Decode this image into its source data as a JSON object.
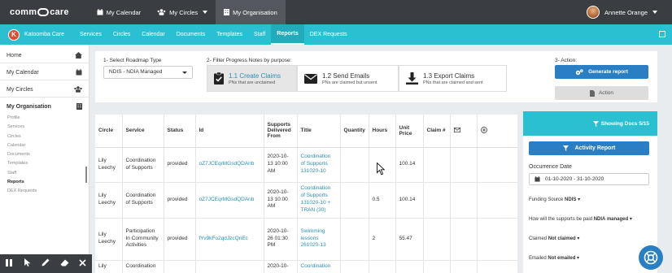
{
  "topbar": {
    "logo_text_a": "comm",
    "logo_text_b": "care",
    "nav": [
      {
        "label": "My Calendar",
        "icon": "calendar-icon"
      },
      {
        "label": "My Circles",
        "icon": "users-icon"
      },
      {
        "label": "My Organisation",
        "icon": "building-icon"
      }
    ],
    "user_name": "Annette Orange"
  },
  "tealbar": {
    "badge": "K",
    "tenant": "Katoomba Care",
    "nav": [
      "Services",
      "Circles",
      "Calendar",
      "Documents",
      "Templates",
      "Staff",
      "Reports",
      "DEX Requests"
    ],
    "active": "Reports"
  },
  "sidebar": {
    "items": [
      "Home",
      "My Calendar",
      "My Circles"
    ],
    "section": "My Organisation",
    "subitems": [
      "Profile",
      "Services",
      "Circles",
      "Calendar",
      "Documents",
      "Templates",
      "Staff",
      "Reports",
      "DEX Requests"
    ]
  },
  "filters": {
    "roadmap_label": "1- Select Roadmap Type",
    "roadmap_value": "NDIS - NDIA Managed",
    "progress_label": "2- Filter Progress Notes by purpose:",
    "steps": [
      {
        "title": "1.1 Create Claims",
        "sub": "PNs that are unclaimed"
      },
      {
        "title": "1.2 Send Emails",
        "sub": "PNs are claimed but unsent"
      },
      {
        "title": "1.3 Export Claims",
        "sub": "PNs that are claimed and sent"
      }
    ],
    "action_label": "3- Action:",
    "generate_label": "Generate report",
    "action_button": "Action"
  },
  "table": {
    "headers": [
      "Circle",
      "Service",
      "Status",
      "Id",
      "Supports Delivered From",
      "Title",
      "Quantity",
      "Hours",
      "Unit Price",
      "Claim #"
    ],
    "rows": [
      {
        "circle": "Lily Leechy",
        "service": "Coordination of Supports",
        "status": "provided",
        "id": "oZ7JCEqrMGsdQDAnb",
        "from": "2020-10-13 10:00 AM",
        "title": "Coordination of Supports 131020-10",
        "quantity": "",
        "hours": "",
        "price": "100.14",
        "claim": ""
      },
      {
        "circle": "Lily Leechy",
        "service": "Coordination of Supports",
        "status": "provided",
        "id": "oZ7JCEqrMGsdQDAnb",
        "from": "2020-10-13 10:00 AM",
        "title": "Coordination of Supports 131020-10 + TRAN (30)",
        "quantity": "",
        "hours": "0.5",
        "price": "100.14",
        "claim": ""
      },
      {
        "circle": "Lily Leechy",
        "service": "Participation In Community Activities",
        "status": "provided",
        "id": "fYv9kFo2qdJzcQnEc",
        "from": "2020-10-26 01:30 PM",
        "title": "Swimming lessons 261020-13",
        "quantity": "",
        "hours": "2",
        "price": "55.47",
        "claim": ""
      },
      {
        "circle": "Lily",
        "service": "Coordination",
        "status": "",
        "id": "",
        "from": "2020-10-",
        "title": "Coordination",
        "quantity": "",
        "hours": "",
        "price": "",
        "claim": ""
      }
    ]
  },
  "rightpanel": {
    "showing": "Showing Docs 5/15",
    "activity_button": "Activity Report",
    "occurrence_label": "Occurrence Date",
    "date_range": "01-10-2020 - 31-10-2020",
    "funding_label": "Funding Source",
    "funding_value": "NDIS",
    "paid_label": "How will the supports be paid",
    "paid_value": "NDIA managed",
    "claimed_label": "Claimed",
    "claimed_value": "Not claimed",
    "emailed_label": "Emailed",
    "emailed_value": "Not emailed"
  },
  "toolbar": {
    "icons": [
      "pause-icon",
      "pointer-icon",
      "pen-icon",
      "eraser-icon",
      "close-icon"
    ]
  },
  "colors": {
    "teal": "#2bbfd2",
    "dark": "#3a3d42",
    "blue": "#2a7fc4",
    "link": "#2a8fb3"
  }
}
